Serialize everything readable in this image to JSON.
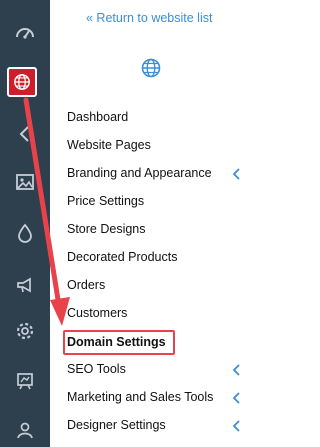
{
  "sidebar": {
    "icons": [
      {
        "name": "dashboard-gauge-icon"
      },
      {
        "name": "globe-icon",
        "active": true
      },
      {
        "name": "chevron-left-icon"
      },
      {
        "name": "image-icon"
      },
      {
        "name": "droplet-icon"
      },
      {
        "name": "megaphone-icon"
      },
      {
        "name": "settings-gear-icon"
      },
      {
        "name": "presentation-icon"
      },
      {
        "name": "user-icon"
      }
    ]
  },
  "panel": {
    "return_link": "« Return to website list",
    "header_icon": "globe-icon",
    "items": [
      {
        "label": "Dashboard",
        "has_submenu": false
      },
      {
        "label": "Website Pages",
        "has_submenu": false
      },
      {
        "label": "Branding and Appearance",
        "has_submenu": true
      },
      {
        "label": "Price Settings",
        "has_submenu": false
      },
      {
        "label": "Store Designs",
        "has_submenu": false
      },
      {
        "label": "Decorated Products",
        "has_submenu": false
      },
      {
        "label": "Orders",
        "has_submenu": false
      },
      {
        "label": "Customers",
        "has_submenu": false
      },
      {
        "label": "Domain Settings",
        "has_submenu": false,
        "highlighted": true
      },
      {
        "label": "SEO Tools",
        "has_submenu": true
      },
      {
        "label": "Marketing and Sales Tools",
        "has_submenu": true
      },
      {
        "label": "Designer Settings",
        "has_submenu": true
      }
    ]
  },
  "colors": {
    "rail_bg": "#2e3f4e",
    "rail_icon": "#c5ced6",
    "link": "#3a8fd8",
    "annotation_red": "#e8424a",
    "chevron": "#3a8fd8"
  }
}
